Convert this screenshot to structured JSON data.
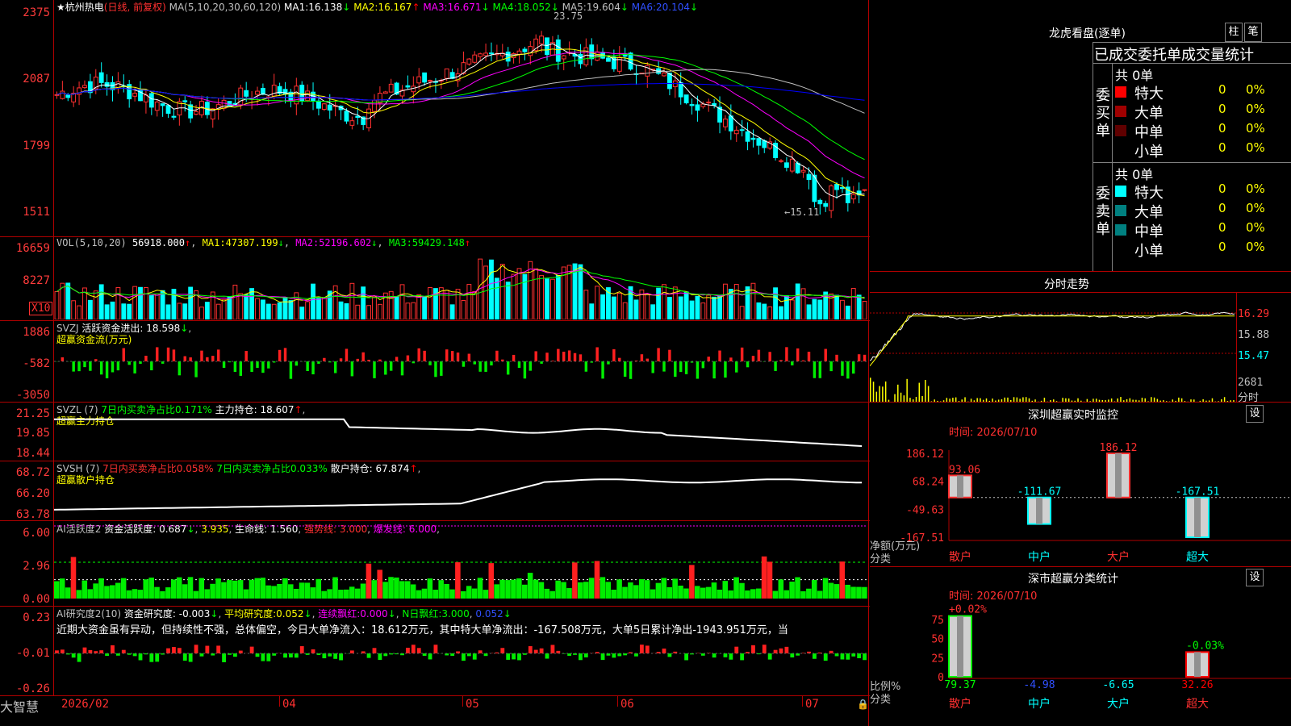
{
  "stock": {
    "name_prefix": "★杭州热电",
    "period": "(日线, 前复权)",
    "ma_label": "MA(5,10,20,30,60,120)",
    "ma": [
      {
        "name": "MA1:",
        "value": "16.138",
        "arrow": "↓",
        "color": "#ffffff"
      },
      {
        "name": "MA2:",
        "value": "16.167",
        "arrow": "↑",
        "color": "#ffff00"
      },
      {
        "name": "MA3:",
        "value": "16.671",
        "arrow": "↓",
        "color": "#ff00ff"
      },
      {
        "name": "MA4:",
        "value": "18.052",
        "arrow": "↓",
        "color": "#00ff00"
      },
      {
        "name": "MA5:",
        "value": "19.604",
        "arrow": "↓",
        "color": "#c0c0c0"
      },
      {
        "name": "MA6:",
        "value": "20.104",
        "arrow": "↓",
        "color": "#0000ff"
      }
    ],
    "high_mark": "23.75",
    "low_mark": "←15.11",
    "price_axis": [
      "2375",
      "2087",
      "1799",
      "1511"
    ]
  },
  "vol": {
    "label": "VOL(5,10,20)",
    "value": "56918.000",
    "arrow": "↑",
    "ma": [
      {
        "name": "MA1:",
        "value": "47307.199",
        "arrow": "↓"
      },
      {
        "name": "MA2:",
        "value": "52196.602",
        "arrow": "↓"
      },
      {
        "name": "MA3:",
        "value": "59429.148",
        "arrow": "↑"
      }
    ],
    "axis": [
      "16659",
      "8227"
    ],
    "unit": "X10"
  },
  "svzj": {
    "label": "SVZJ",
    "desc": "活跃资金进出:",
    "value": "18.598",
    "arrow": "↓",
    "sub": "超赢资金流(万元)",
    "axis": [
      "1886",
      "-582",
      "-3050"
    ]
  },
  "svzl": {
    "label": "SVZL (7)",
    "d1": "7日内买卖净占比0.171%",
    "d2": "主力持仓:",
    "value": "18.607",
    "arrow": "↑",
    "sub": "超赢主力持仓",
    "axis": [
      "21.25",
      "19.85",
      "18.44"
    ]
  },
  "svsh": {
    "label": "SVSH (7)",
    "d1": "7日内买卖净占比0.058%",
    "d2": "7日内买卖净占比0.033%",
    "d3": "散户持仓:",
    "value": "67.874",
    "arrow": "↑",
    "sub": "超赢散户持仓",
    "axis": [
      "68.72",
      "66.20",
      "63.78"
    ]
  },
  "ai1": {
    "label": "AI活跃度2",
    "d1": "资金活跃度:",
    "v1": "0.687",
    "a1": "↓",
    "v2": "3.935",
    "d2": "生命线:",
    "v3": "1.560",
    "d3": "强势线:",
    "v4": "3.000",
    "d4": "爆发线:",
    "v5": "6.000",
    "axis": [
      "6.00",
      "2.96",
      "0.00"
    ]
  },
  "ai2": {
    "label": "AI研究度2(10)",
    "d1": "资金研究度:",
    "v1": "-0.003",
    "a1": "↓",
    "d2": "平均研究度:",
    "v2": "0.052",
    "a2": "↓",
    "d3": "连续飘红:",
    "v3": "0.000",
    "a3": "↓",
    "d4": "N日飘红:",
    "v4": "3.000",
    "v5": "0.052",
    "a5": "↓",
    "comment": "近期大资金虽有异动，但持续性不强，总体偏空，今日大单净流入：18.612万元，其中特大单净流出：-167.508万元，大单5日累计净出-1943.951万元，当",
    "axis": [
      "0.23",
      "-0.01",
      "-0.26"
    ]
  },
  "xaxis": [
    "2026/02",
    "04",
    "05",
    "06",
    "07"
  ],
  "brand": "大智慧",
  "right": {
    "dragon_title": "龙虎看盘(逐单)",
    "btn_bar": "柱",
    "btn_pen": "笔",
    "tabs_title": "已成交委托单成交量统计",
    "buy_label": "委买单",
    "sell_label": "委卖单",
    "buy_total": "共 0单",
    "sell_total": "共 0单",
    "buy_rows": [
      {
        "name": "特大",
        "count": "0",
        "pct": "0%",
        "color": "#ff0000"
      },
      {
        "name": "大单",
        "count": "0",
        "pct": "0%",
        "color": "#a00000"
      },
      {
        "name": "中单",
        "count": "0",
        "pct": "0%",
        "color": "#600000"
      },
      {
        "name": "小单",
        "count": "0",
        "pct": "0%",
        "color": ""
      }
    ],
    "sell_rows": [
      {
        "name": "特大",
        "count": "0",
        "pct": "0%",
        "color": "#00ffff"
      },
      {
        "name": "大单",
        "count": "0",
        "pct": "0%",
        "color": "#008080"
      },
      {
        "name": "中单",
        "count": "0",
        "pct": "0%",
        "color": "#008080"
      },
      {
        "name": "小单",
        "count": "0",
        "pct": "0%",
        "color": ""
      }
    ],
    "intraday_title": "分时走势",
    "intraday_axis": [
      "16.29",
      "15.88",
      "15.47",
      "2681"
    ],
    "intraday_unit": "分时",
    "sz_title": "深圳超赢实时监控",
    "sz_btn": "设",
    "sz_time": "时间: 2026/07/10",
    "sz_axis": [
      "186.12",
      "68.24",
      "-49.63",
      "-167.51"
    ],
    "sz_ylabel": "净额(万元)",
    "sz_xlabel": "分类",
    "sz_bars": [
      {
        "name": "散户",
        "value": 93.06,
        "label": "93.06",
        "color": "#ff3030"
      },
      {
        "name": "中户",
        "value": -111.67,
        "label": "-111.67",
        "color": "#00ffff"
      },
      {
        "name": "大户",
        "value": 186.12,
        "label": "186.12",
        "color": "#ff3030"
      },
      {
        "name": "超大",
        "value": -167.51,
        "label": "-167.51",
        "color": "#00ffff"
      }
    ],
    "cls_title": "深市超赢分类统计",
    "cls_btn": "设",
    "cls_time": "时间: 2026/07/10",
    "cls_axis": [
      "75",
      "50",
      "25",
      "0"
    ],
    "cls_ylabel": "比例%",
    "cls_xlabel": "分类",
    "cls_bars": [
      {
        "name": "散户",
        "value": 79.37,
        "label": "79.37",
        "top": "+0.02%",
        "color": "#00ff00"
      },
      {
        "name": "中户",
        "value": 4.98,
        "label": "-4.98",
        "top": "",
        "color": "#0000ff"
      },
      {
        "name": "大户",
        "value": 6.65,
        "label": "-6.65",
        "top": "",
        "color": "#00ffff"
      },
      {
        "name": "超大",
        "value": 32.26,
        "label": "32.26",
        "top": "-0.03%",
        "color": "#ff0000"
      }
    ]
  }
}
